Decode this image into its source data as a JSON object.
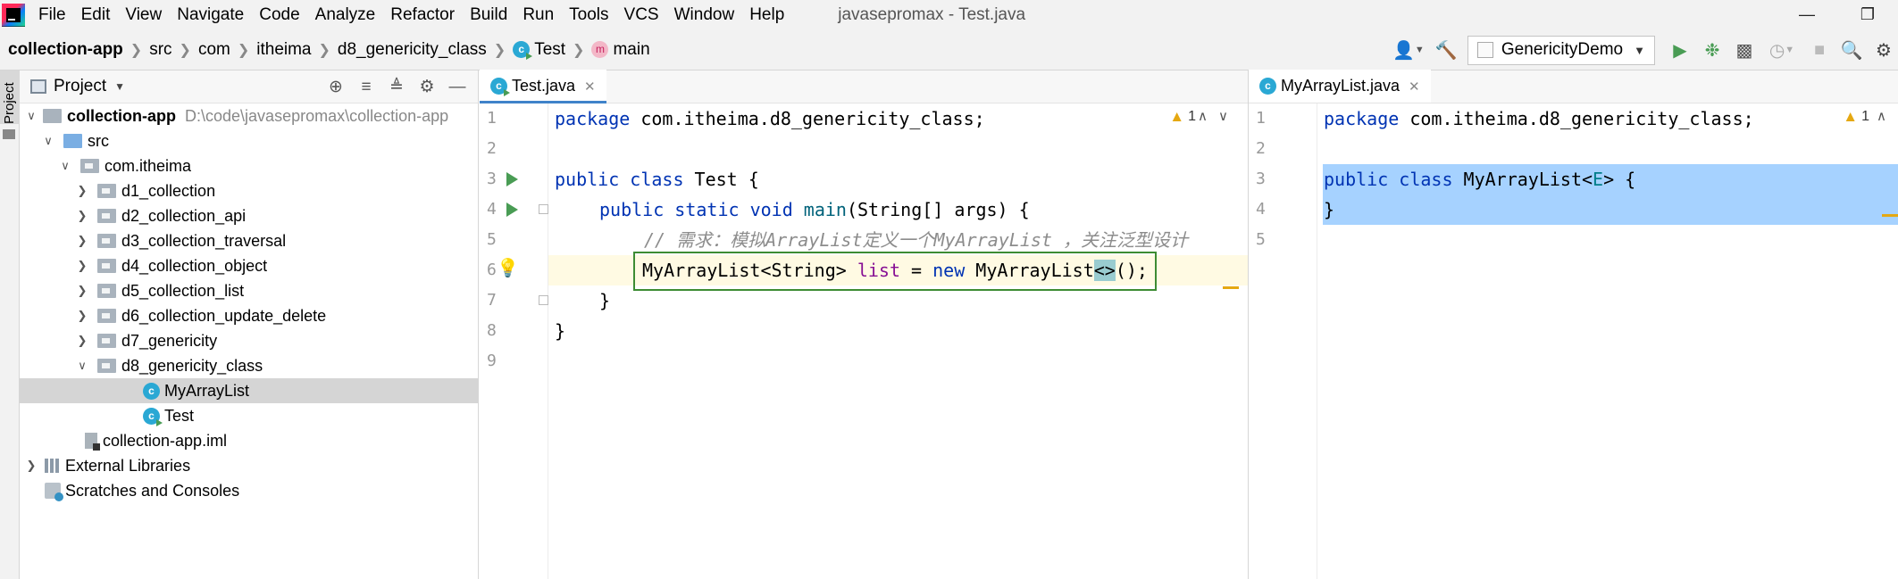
{
  "menubar": {
    "items": [
      "File",
      "Edit",
      "View",
      "Navigate",
      "Code",
      "Analyze",
      "Refactor",
      "Build",
      "Run",
      "Tools",
      "VCS",
      "Window",
      "Help"
    ],
    "title": "javasepromax - Test.java"
  },
  "breadcrumb": {
    "project": "collection-app",
    "parts": [
      "src",
      "com",
      "itheima",
      "d8_genericity_class"
    ],
    "class_name": "Test",
    "method_name": "main"
  },
  "toolbar": {
    "run_config": "GenericityDemo"
  },
  "side_strip": {
    "label": "Project"
  },
  "project_panel": {
    "title": "Project",
    "root_name": "collection-app",
    "root_path": "D:\\code\\javasepromax\\collection-app",
    "src": "src",
    "package": "com.itheima",
    "folders": [
      "d1_collection",
      "d2_collection_api",
      "d3_collection_traversal",
      "d4_collection_object",
      "d5_collection_list",
      "d6_collection_update_delete",
      "d7_genericity",
      "d8_genericity_class"
    ],
    "classes": [
      "MyArrayList",
      "Test"
    ],
    "iml_file": "collection-app.iml",
    "external_libraries": "External Libraries",
    "scratches": "Scratches and Consoles"
  },
  "editor_left": {
    "tab": "Test.java",
    "warning_count": "1",
    "line_numbers": [
      "1",
      "2",
      "3",
      "4",
      "5",
      "6",
      "7",
      "8",
      "9"
    ],
    "code": {
      "l1_kw": "package",
      "l1_rest": " com.itheima.d8_genericity_class;",
      "l3_kw": "public class",
      "l3_rest": " Test {",
      "l4_kw": "public static void",
      "l4_fn": "main",
      "l4_rest": "(String[] args) {",
      "l5_comment": "// 需求：模拟ArrayList定义一个MyArrayList ，关注泛型设计",
      "l6_type": "MyArrayList<String> ",
      "l6_var": "list",
      "l6_eq": " = ",
      "l6_new": "new",
      "l6_ctor": " MyArrayList",
      "l6_diamond": "<>",
      "l6_end": "();",
      "l7": "}",
      "l8": "}"
    }
  },
  "editor_right": {
    "tab": "MyArrayList.java",
    "warning_count": "1",
    "line_numbers": [
      "1",
      "2",
      "3",
      "4",
      "5"
    ],
    "code": {
      "l1_kw": "package",
      "l1_rest": " com.itheima.d8_genericity_class;",
      "l3_kw": "public class",
      "l3_name": " MyArrayList<",
      "l3_gen": "E",
      "l3_end": "> {",
      "l4": "}"
    }
  },
  "colors": {
    "keyword": "#0033b3",
    "comment": "#8c8c8c",
    "selection": "#a6d2ff",
    "run_green": "#499c54"
  }
}
